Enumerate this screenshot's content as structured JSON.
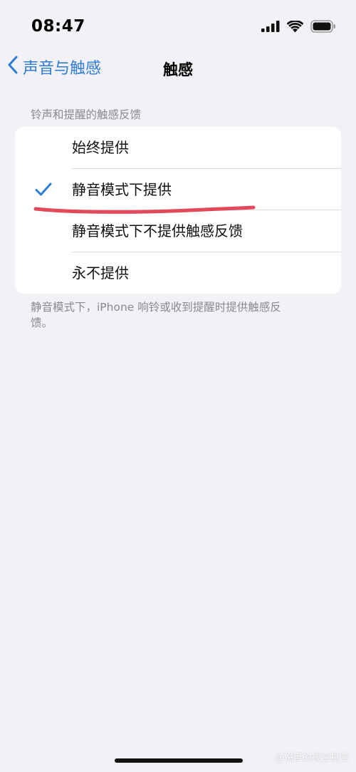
{
  "status_bar": {
    "time": "08:47"
  },
  "nav": {
    "back_label": "声音与触感",
    "title": "触感"
  },
  "section": {
    "header": "铃声和提醒的触感反馈",
    "options": [
      {
        "label": "始终提供",
        "selected": false
      },
      {
        "label": "静音模式下提供",
        "selected": true
      },
      {
        "label": "静音模式下不提供触感反馈",
        "selected": false
      },
      {
        "label": "永不提供",
        "selected": false
      }
    ],
    "footer": "静音模式下，iPhone 响铃或收到提醒时提供触感反馈。"
  },
  "watermark": "@悦目的夜空星空",
  "colors": {
    "accent": "#2e7cd6",
    "annotation": "#e24a5a",
    "background": "#f2f1f6"
  },
  "icons": {
    "back": "chevron-left-icon",
    "check": "checkmark-icon",
    "signal": "cellular-signal-icon",
    "wifi": "wifi-icon",
    "battery": "battery-icon"
  }
}
